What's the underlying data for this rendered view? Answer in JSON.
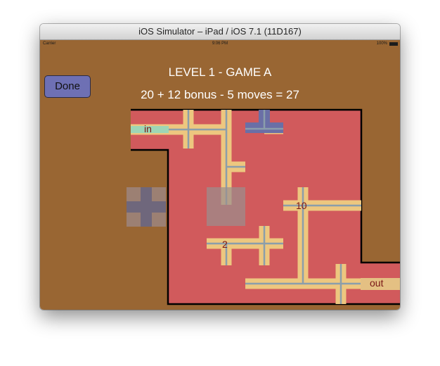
{
  "window": {
    "title": "iOS Simulator – iPad / iOS 7.1 (11D167)"
  },
  "status_bar": {
    "carrier": "Carrier",
    "time": "9:06 PM",
    "battery": "100%"
  },
  "game": {
    "done_label": "Done",
    "level_title": "LEVEL 1 - GAME A",
    "score_line": "20 + 12 bonus - 5 moves = 27",
    "in_label": "in",
    "out_label": "out",
    "tile_labels": [
      "10",
      "2"
    ]
  },
  "colors": {
    "background": "#996633",
    "board": "#d15a5c",
    "pipe": "#edc77f",
    "pipe_core": "#8b9eab",
    "water": "#9dd6b6",
    "button": "#6e70b4",
    "placed_tile": "#6a6fa6"
  }
}
